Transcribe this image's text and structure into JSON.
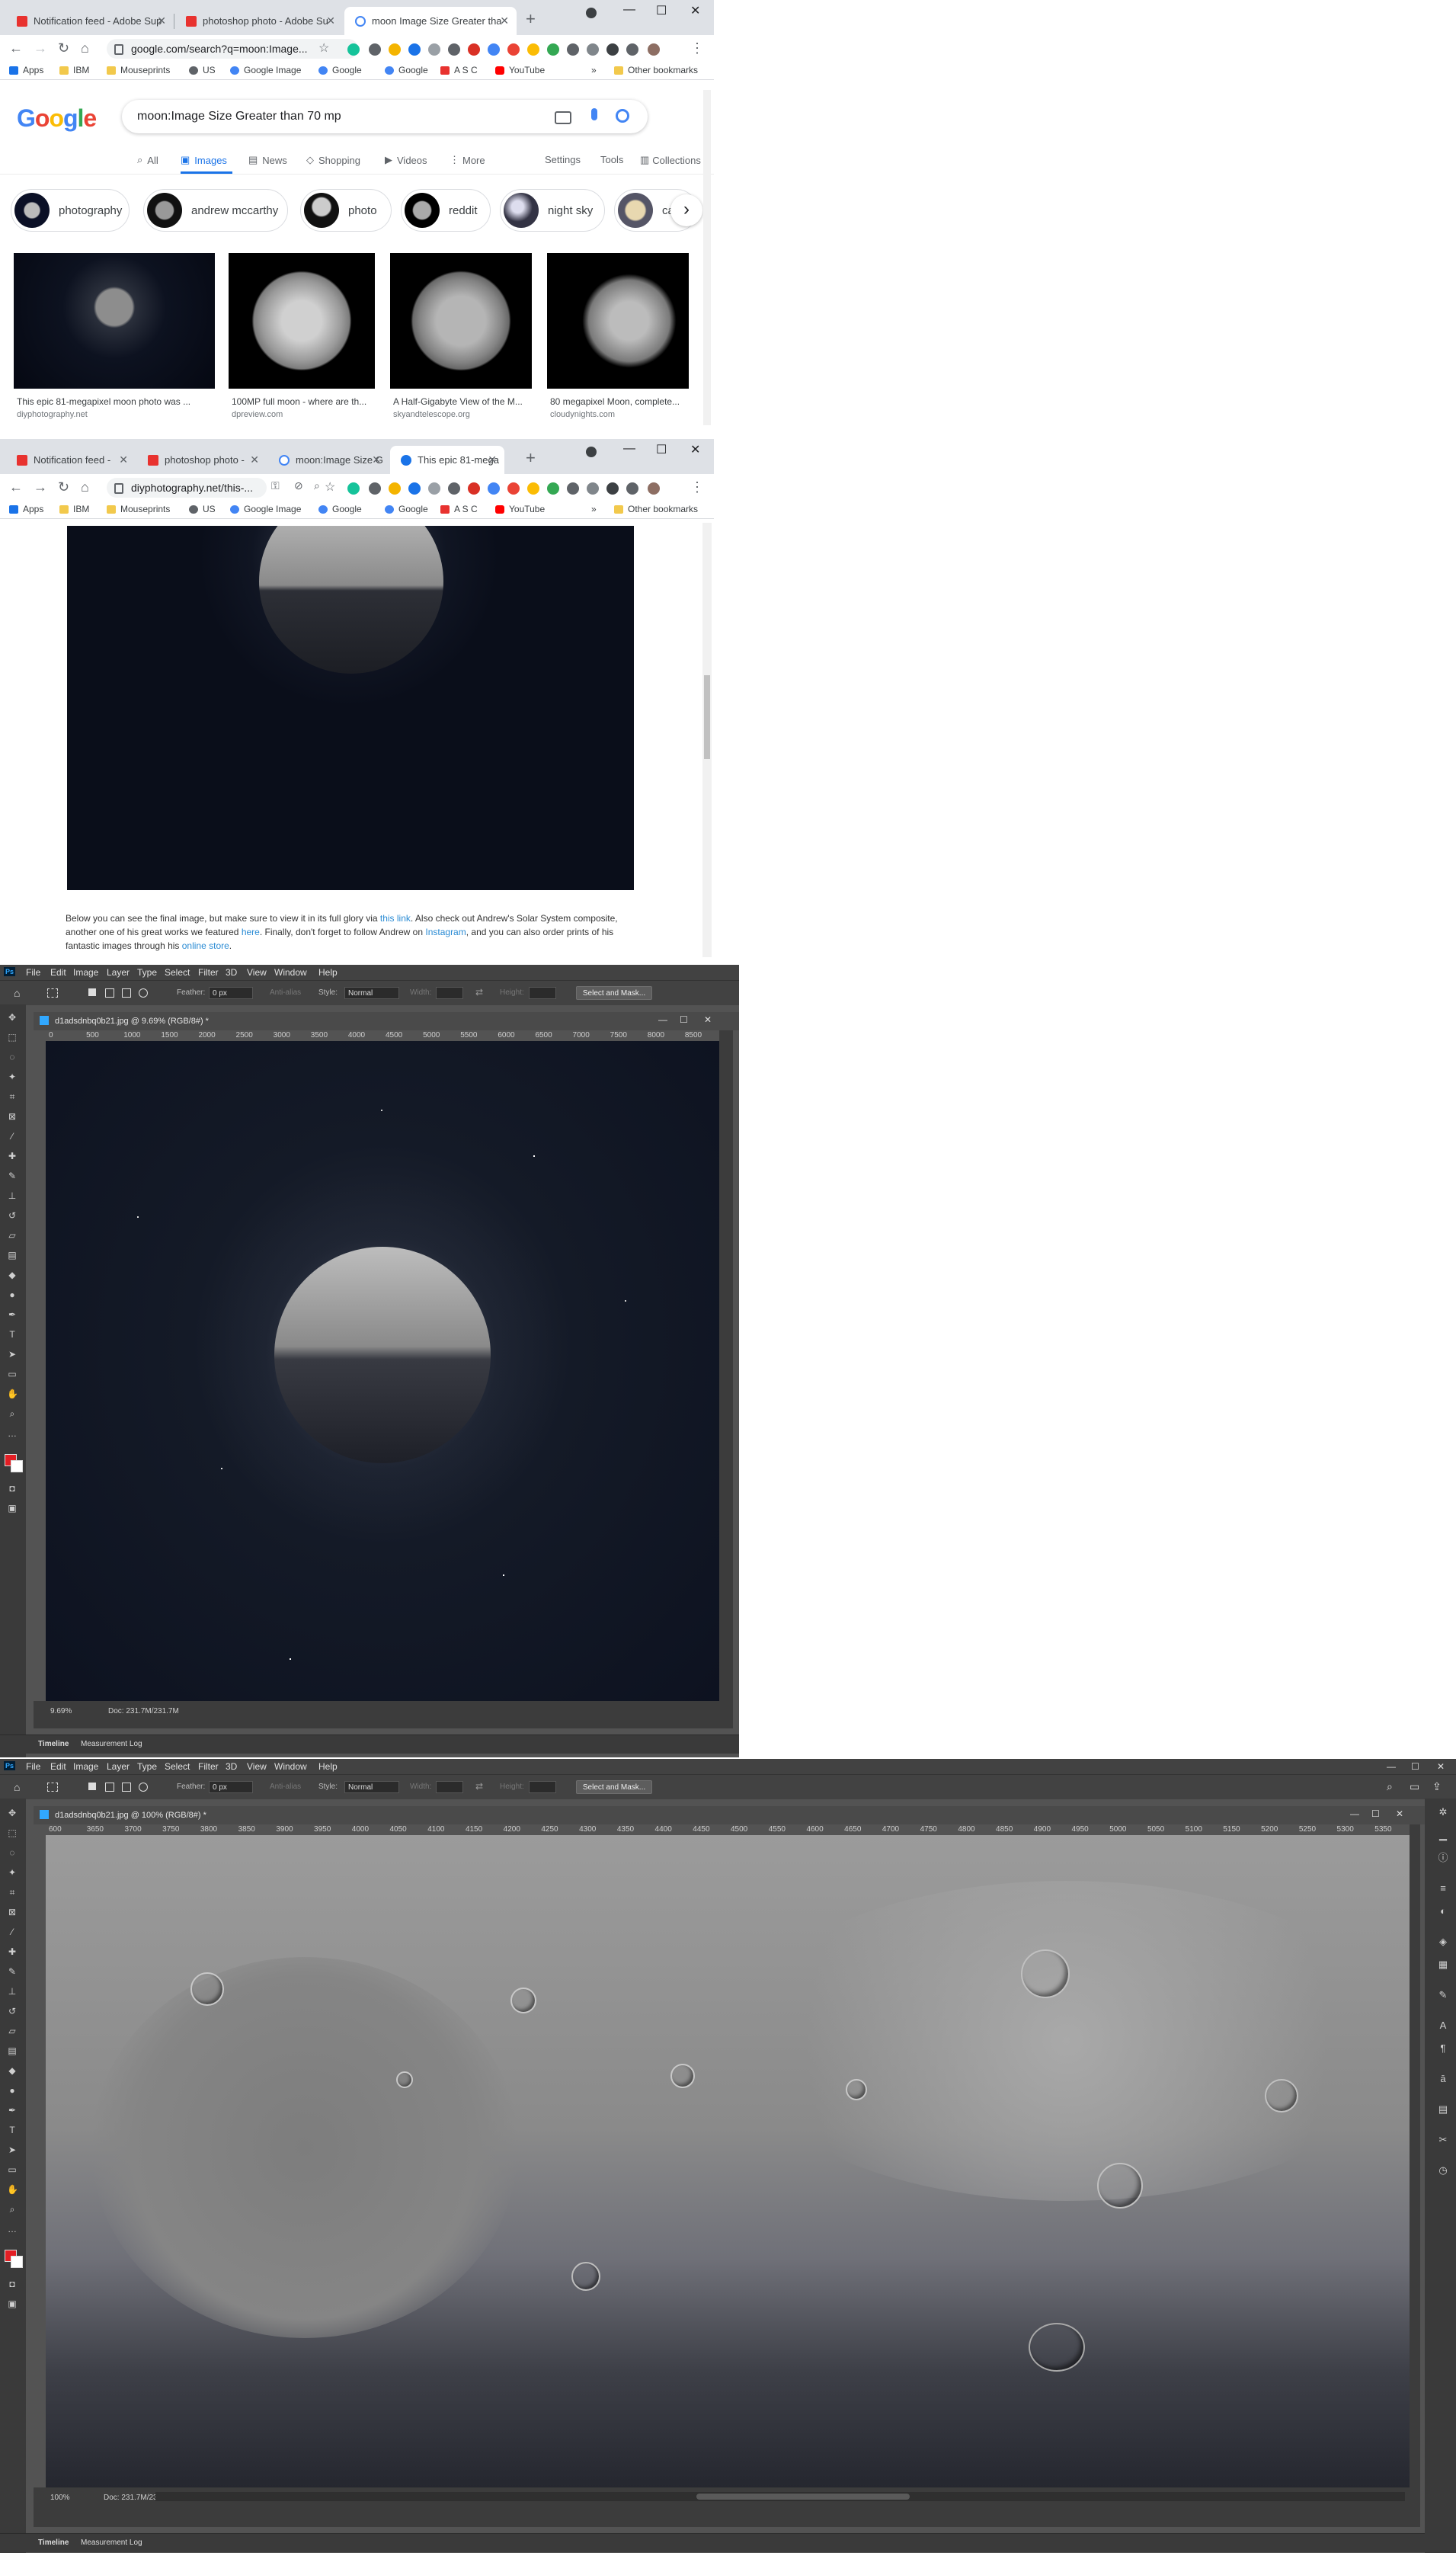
{
  "browser1": {
    "tabs": [
      {
        "label": "Notification feed - Adobe Sup"
      },
      {
        "label": "photoshop photo - Adobe Su"
      },
      {
        "label": "moon Image Size Greater tha"
      }
    ],
    "url": "google.com/search?q=moon:Image...",
    "bookmarks": [
      "Apps",
      "IBM",
      "Mouseprints",
      "US",
      "Google Image",
      "Google",
      "Google",
      "A S C",
      "YouTube"
    ],
    "bookmarks_more": "»",
    "other_bookmarks": "Other bookmarks",
    "google": {
      "logo": "Google",
      "query": "moon:Image Size Greater than 70 mp",
      "tabs": [
        "All",
        "Images",
        "News",
        "Shopping",
        "Videos",
        "More"
      ],
      "tools": [
        "Settings",
        "Tools",
        "Collections"
      ],
      "chips": [
        "photography",
        "andrew mccarthy",
        "photo",
        "reddit",
        "night sky",
        "ca"
      ],
      "results": [
        {
          "caption": "This epic 81-megapixel moon photo was ...",
          "source": "diyphotography.net"
        },
        {
          "caption": "100MP full moon - where are th...",
          "source": "dpreview.com"
        },
        {
          "caption": "A Half-Gigabyte View of the M...",
          "source": "skyandtelescope.org"
        },
        {
          "caption": "80 megapixel Moon, complete...",
          "source": "cloudynights.com"
        }
      ]
    }
  },
  "browser2": {
    "tabs": [
      {
        "label": "Notification feed -"
      },
      {
        "label": "photoshop photo -"
      },
      {
        "label": "moon:Image Size G"
      },
      {
        "label": "This epic 81-mega"
      }
    ],
    "url": "diyphotography.net/this-...",
    "bookmarks": [
      "Apps",
      "IBM",
      "Mouseprints",
      "US",
      "Google Image",
      "Google",
      "Google",
      "A S C",
      "YouTube"
    ],
    "bookmarks_more": "»",
    "other_bookmarks": "Other bookmarks",
    "article": {
      "p1": "Below you can see the final image, but make sure to view it in its full glory via ",
      "link1": "this link",
      "p2": ". Also check out Andrew's Solar System composite, another one of his great works we featured ",
      "link2": "here",
      "p3": ". Finally, don't forget to follow Andrew on ",
      "link3": "Instagram",
      "p4": ", and you can also order prints of his fantastic images through his ",
      "link4": "online store",
      "p5": "."
    }
  },
  "ps1": {
    "menu": [
      "File",
      "Edit",
      "Image",
      "Layer",
      "Type",
      "Select",
      "Filter",
      "3D",
      "View",
      "Window",
      "Help"
    ],
    "options": {
      "feather_label": "Feather:",
      "feather_value": "0 px",
      "antialias": "Anti-alias",
      "style_label": "Style:",
      "style_value": "Normal",
      "width_label": "Width:",
      "height_label": "Height:",
      "select_mask": "Select and Mask..."
    },
    "doc_title": "d1adsdnbq0b21.jpg @ 9.69% (RGB/8#) *",
    "ruler": [
      "0",
      "500",
      "1000",
      "1500",
      "2000",
      "2500",
      "3000",
      "3500",
      "4000",
      "4500",
      "5000",
      "5500",
      "6000",
      "6500",
      "7000",
      "7500",
      "8000",
      "8500"
    ],
    "zoom": "9.69%",
    "doc_size": "Doc: 231.7M/231.7M",
    "timeline": [
      "Timeline",
      "Measurement Log"
    ]
  },
  "ps2": {
    "menu": [
      "File",
      "Edit",
      "Image",
      "Layer",
      "Type",
      "Select",
      "Filter",
      "3D",
      "View",
      "Window",
      "Help"
    ],
    "options": {
      "feather_label": "Feather:",
      "feather_value": "0 px",
      "antialias": "Anti-alias",
      "style_label": "Style:",
      "style_value": "Normal",
      "width_label": "Width:",
      "height_label": "Height:",
      "select_mask": "Select and Mask..."
    },
    "doc_title": "d1adsdnbq0b21.jpg @ 100% (RGB/8#) *",
    "ruler": [
      "600",
      "3650",
      "3700",
      "3750",
      "3800",
      "3850",
      "3900",
      "3950",
      "4000",
      "4050",
      "4100",
      "4150",
      "4200",
      "4250",
      "4300",
      "4350",
      "4400",
      "4450",
      "4500",
      "4550",
      "4600",
      "4650",
      "4700",
      "4750",
      "4800",
      "4850",
      "4900",
      "4950",
      "5000",
      "5050",
      "5100",
      "5150",
      "5200",
      "5250",
      "5300",
      "5350"
    ],
    "zoom": "100%",
    "doc_size": "Doc: 231.7M/231.7M",
    "timeline": [
      "Timeline",
      "Measurement Log"
    ]
  }
}
